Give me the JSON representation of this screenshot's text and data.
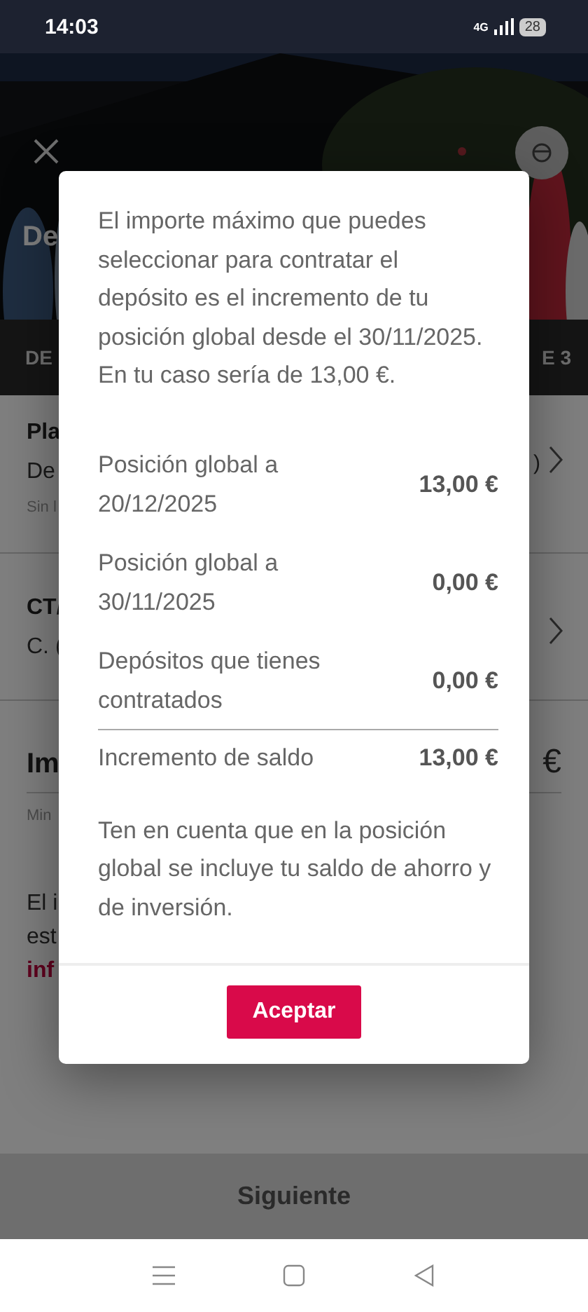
{
  "status_bar": {
    "time": "14:03",
    "network": "4G",
    "battery": "28"
  },
  "header": {
    "title": "De"
  },
  "tabs": [
    {
      "label": "DE"
    },
    {
      "label": "E 3"
    }
  ],
  "sections": [
    {
      "kind": "product",
      "title": "Pla",
      "line": "De",
      "value": ")",
      "note": "Sin l"
    },
    {
      "kind": "account",
      "title": "CT/",
      "line": "C. ("
    },
    {
      "kind": "amount",
      "title": "Im",
      "value": "€",
      "note": "Min"
    }
  ],
  "info": {
    "lines": [
      "El i",
      "est"
    ],
    "link": "inf"
  },
  "dialog": {
    "message": "El importe máximo que puedes seleccionar para contratar el depósito es el incremento de tu posición global desde el 30/11/2025. En tu caso sería de 13,00 €.",
    "rows": [
      {
        "label": "Posición global a 20/12/2025",
        "value": "13,00 €"
      },
      {
        "label": "Posición global a 30/11/2025",
        "value": "0,00 €"
      },
      {
        "label": "Depósitos que tienes contratados",
        "value": "0,00 €"
      }
    ],
    "total": {
      "label": "Incremento de saldo",
      "value": "13,00 €"
    },
    "note": "Ten en cuenta que en la posición global se incluye tu saldo de ahorro y de inversión.",
    "button": "Aceptar"
  },
  "footer_button": "Siguiente"
}
